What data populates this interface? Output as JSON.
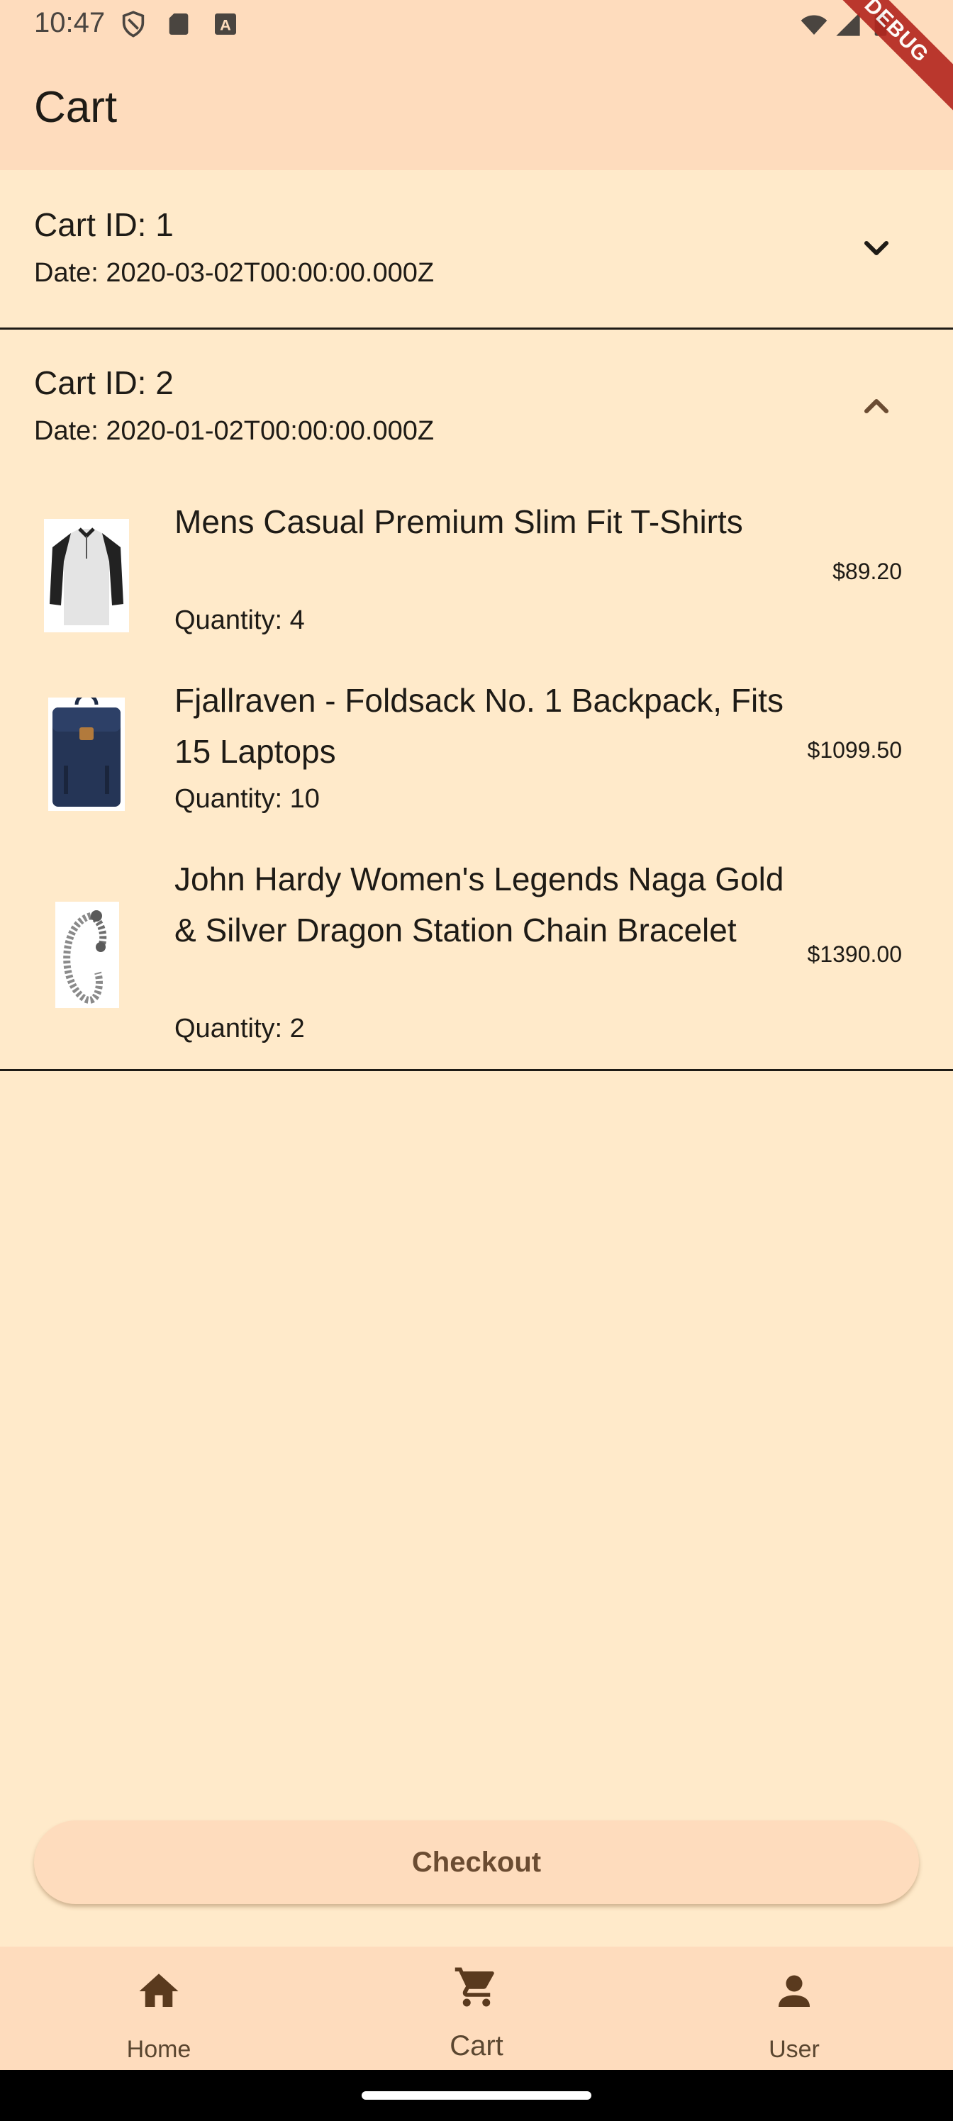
{
  "status": {
    "time": "10:47",
    "icons": [
      "shield-icon",
      "sd-card-icon",
      "a-badge-icon",
      "wifi-icon",
      "signal-icon",
      "battery-icon"
    ]
  },
  "debug_banner": "DEBUG",
  "appbar": {
    "title": "Cart"
  },
  "carts": [
    {
      "title": "Cart ID: 1",
      "date": "Date: 2020-03-02T00:00:00.000Z",
      "expanded": false,
      "chevron": "chevron-down-icon"
    },
    {
      "title": "Cart ID: 2",
      "date": "Date: 2020-01-02T00:00:00.000Z",
      "expanded": true,
      "chevron": "chevron-up-icon"
    }
  ],
  "items": [
    {
      "name": "Mens Casual Premium Slim Fit T-Shirts",
      "quantity": "Quantity: 4",
      "price": "$89.20",
      "image": "tshirt-image"
    },
    {
      "name": "Fjallraven - Foldsack No. 1 Backpack, Fits 15 Laptops",
      "quantity": "Quantity: 10",
      "price": "$1099.50",
      "image": "backpack-image"
    },
    {
      "name": "John Hardy Women's Legends Naga Gold & Silver Dragon Station Chain Bracelet",
      "quantity": "Quantity: 2",
      "price": "$1390.00",
      "image": "bracelet-image"
    }
  ],
  "checkout": {
    "label": "Checkout"
  },
  "nav": {
    "items": [
      {
        "label": "Home",
        "icon": "home-icon"
      },
      {
        "label": "Cart",
        "icon": "cart-icon",
        "selected": true
      },
      {
        "label": "User",
        "icon": "user-icon"
      }
    ]
  },
  "colors": {
    "background": "#ffeaca",
    "appbar": "#fedcbd",
    "accent_brown": "#6b4c32",
    "debug": "#b3261e"
  }
}
